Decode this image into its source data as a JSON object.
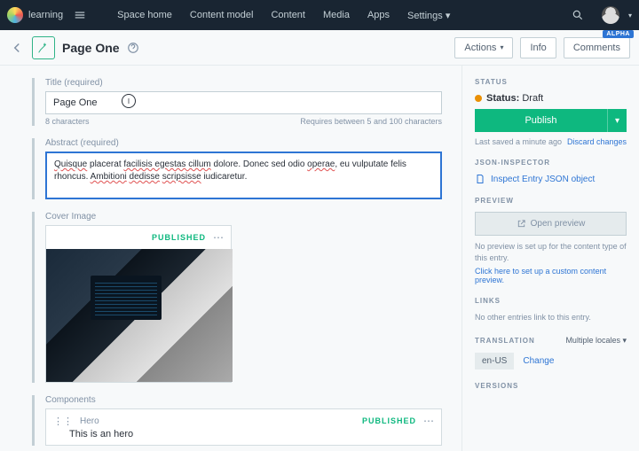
{
  "topbar": {
    "space": "learning",
    "menu": [
      "Space home",
      "Content model",
      "Content",
      "Media",
      "Apps",
      "Settings"
    ]
  },
  "subbar": {
    "title": "Page One",
    "actions": "Actions",
    "info": "Info",
    "comments": "Comments",
    "alpha": "ALPHA"
  },
  "fields": {
    "title": {
      "label": "Title (required)",
      "value": "Page One",
      "chars": "8 characters",
      "req": "Requires between 5 and 100 characters"
    },
    "abstract": {
      "label": "Abstract (required)",
      "parts": [
        "Quisque",
        " placerat ",
        "facilisis egestas cillum",
        " dolore. Donec sed odio ",
        "operae",
        ", eu vulputate felis rhoncus. ",
        "Ambitioni",
        " ",
        "dedisse",
        " ",
        "scripsisse",
        " iudicaretur."
      ]
    },
    "cover": {
      "label": "Cover Image",
      "status": "PUBLISHED"
    },
    "components": {
      "label": "Components",
      "items": [
        {
          "type": "Hero",
          "text": "This is an hero",
          "status": "PUBLISHED"
        }
      ]
    }
  },
  "sidebar": {
    "status": {
      "head": "Status",
      "label": "Status:",
      "value": "Draft",
      "publish": "Publish",
      "saved": "Last saved a minute ago",
      "discard": "Discard changes"
    },
    "json": {
      "head": "JSON-Inspector",
      "link": "Inspect Entry JSON object"
    },
    "preview": {
      "head": "Preview",
      "btn": "Open preview",
      "text": "No preview is set up for the content type of this entry.",
      "link": "Click here to set up a custom content preview."
    },
    "links": {
      "head": "Links",
      "text": "No other entries link to this entry."
    },
    "translation": {
      "head": "Translation",
      "sel": "Multiple locales",
      "locale": "en-US",
      "change": "Change"
    },
    "versions": {
      "head": "Versions"
    }
  }
}
